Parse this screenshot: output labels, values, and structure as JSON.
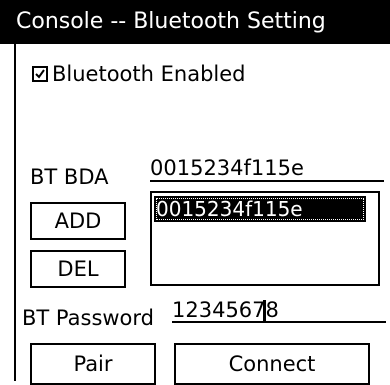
{
  "window": {
    "title": "Console -- Bluetooth Setting"
  },
  "bluetooth": {
    "enabled_label": "Bluetooth Enabled",
    "enabled": true
  },
  "bda": {
    "label": "BT BDA",
    "value": "0015234f115e"
  },
  "buttons": {
    "add": "ADD",
    "del": "DEL",
    "pair": "Pair",
    "connect": "Connect"
  },
  "devices": {
    "items": [
      "0015234f115e"
    ],
    "selected_index": 0
  },
  "password": {
    "label": "BT Password",
    "value": "12345678"
  }
}
